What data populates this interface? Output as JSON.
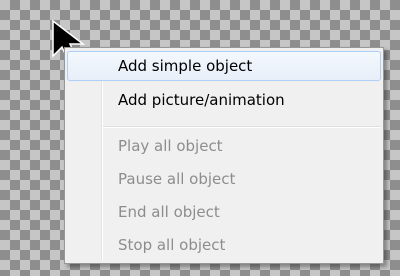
{
  "context_menu": {
    "items": [
      {
        "label": "Add simple object",
        "enabled": true,
        "hovered": true
      },
      {
        "label": "Add picture/animation",
        "enabled": true,
        "hovered": false
      },
      {
        "label": "Play all object",
        "enabled": false,
        "hovered": false
      },
      {
        "label": "Pause all object",
        "enabled": false,
        "hovered": false
      },
      {
        "label": "End all object",
        "enabled": false,
        "hovered": false
      },
      {
        "label": "Stop all object",
        "enabled": false,
        "hovered": false
      }
    ]
  },
  "colors": {
    "checker_light": "#c6c6c6",
    "checker_dark": "#8e8e8e",
    "menu_bg": "#f0f0f0",
    "hover_border": "#aecff7",
    "disabled_text": "#8d8d8d"
  },
  "icons": {
    "cursor": "arrow-cursor-icon"
  }
}
